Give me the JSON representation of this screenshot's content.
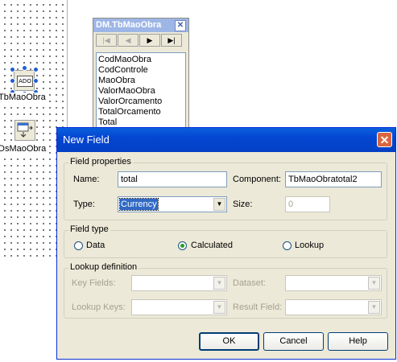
{
  "designer": {
    "components": [
      {
        "label": "TbMaoObra",
        "icon_text": "ADO"
      },
      {
        "label": "DsMaoObra"
      }
    ]
  },
  "fields_editor": {
    "title": "DM.TbMaoObra",
    "nav_buttons": [
      "first",
      "prior",
      "next",
      "last"
    ],
    "fields": [
      "CodMaoObra",
      "CodControle",
      "MaoObra",
      "ValorMaoObra",
      "ValorOrcamento",
      "TotalOrcamento",
      "Total"
    ]
  },
  "dialog": {
    "title": "New Field",
    "field_properties": {
      "legend": "Field properties",
      "name_label": "Name:",
      "name_value": "total",
      "component_label": "Component:",
      "component_value": "TbMaoObratotal2",
      "type_label": "Type:",
      "type_value": "Currency",
      "size_label": "Size:",
      "size_value": "0"
    },
    "field_type": {
      "legend": "Field type",
      "options": [
        "Data",
        "Calculated",
        "Lookup"
      ],
      "selected": "Calculated"
    },
    "lookup_definition": {
      "legend": "Lookup definition",
      "key_fields_label": "Key Fields:",
      "dataset_label": "Dataset:",
      "lookup_keys_label": "Lookup Keys:",
      "result_field_label": "Result Field:"
    },
    "buttons": {
      "ok": "OK",
      "cancel": "Cancel",
      "help": "Help"
    }
  }
}
